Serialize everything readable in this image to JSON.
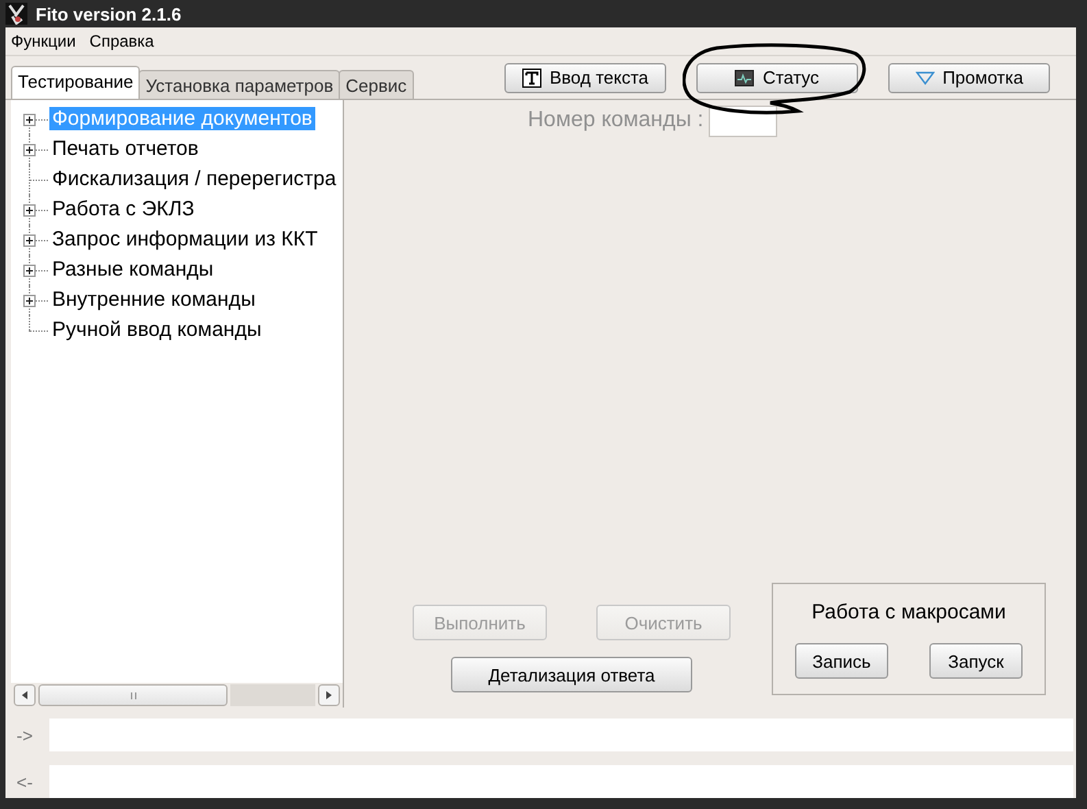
{
  "window": {
    "title": "Fito version 2.1.6"
  },
  "menu": [
    "Функции",
    "Справка"
  ],
  "tabs": [
    {
      "label": "Тестирование",
      "selected": true
    },
    {
      "label": "Установка параметров",
      "selected": false
    },
    {
      "label": "Сервис",
      "selected": false
    }
  ],
  "toolbar": [
    {
      "label": "Ввод текста",
      "kind": "text"
    },
    {
      "label": "Статус",
      "kind": "monitor"
    },
    {
      "label": "Промотка",
      "kind": "dropdown"
    }
  ],
  "tree": {
    "items": [
      {
        "label": "Формирование документов",
        "expandable": true,
        "selected": true
      },
      {
        "label": "Печать отчетов",
        "expandable": true,
        "selected": false
      },
      {
        "label": "Фискализация / перерегистра",
        "expandable": false,
        "selected": false
      },
      {
        "label": "Работа с ЭКЛЗ",
        "expandable": true,
        "selected": false
      },
      {
        "label": "Запрос информации из ККТ",
        "expandable": true,
        "selected": false
      },
      {
        "label": "Разные команды",
        "expandable": true,
        "selected": false
      },
      {
        "label": "Внутренние команды",
        "expandable": true,
        "selected": false
      },
      {
        "label": "Ручной ввод команды",
        "expandable": false,
        "selected": false
      }
    ]
  },
  "command_number": {
    "label": "Номер команды :"
  },
  "actions": [
    {
      "label": "Выполнить",
      "disabled": true
    },
    {
      "label": "Очистить",
      "disabled": true
    }
  ],
  "detail_button": {
    "label": "Детализация ответа",
    "disabled": false
  },
  "macros": {
    "title": "Работа с макросами",
    "buttons": [
      "Запись",
      "Запуск"
    ]
  },
  "console": [
    {
      "prompt": "->"
    },
    {
      "prompt": "<-"
    }
  ]
}
